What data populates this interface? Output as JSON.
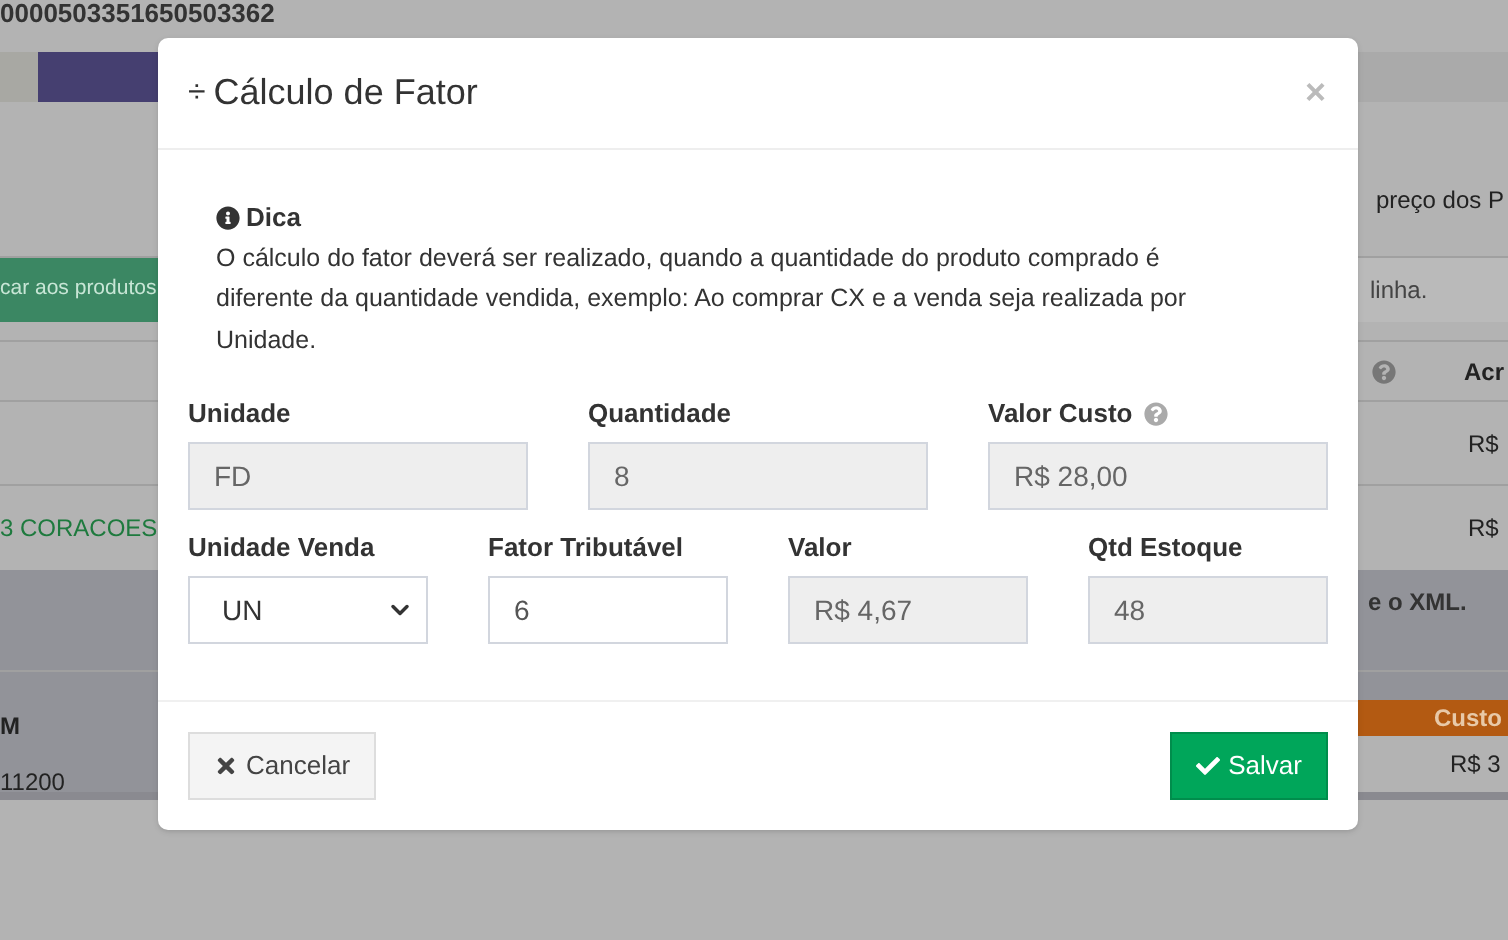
{
  "background": {
    "code": "0000503351650503362",
    "apply_button": "car aos produtos",
    "price_text": "preço dos P",
    "line_text": "linha.",
    "table_header": "Acr",
    "row_values": [
      "R$",
      "R$"
    ],
    "product_name": "3 CORACOES",
    "xml_note": "e o XML.",
    "column_m": "M",
    "code_value": "11200",
    "cost_header": "Custo",
    "cost_value": "R$ 3"
  },
  "modal": {
    "icon": "÷",
    "title": "Cálculo de Fator",
    "close": "×",
    "tip": {
      "title": "Dica",
      "text": "O cálculo do fator deverá ser realizado, quando a quantidade do produto comprado é diferente da quantidade vendida, exemplo: Ao comprar CX e a venda seja realizada por Unidade."
    },
    "rows": [
      [
        {
          "label": "Unidade",
          "kind": "readonly",
          "value": "FD",
          "help": false
        },
        {
          "label": "Quantidade",
          "kind": "readonly",
          "value": "8",
          "help": false
        },
        {
          "label": "Valor Custo",
          "kind": "readonly",
          "value": "R$ 28,00",
          "help": true
        }
      ],
      [
        {
          "label": "Unidade Venda",
          "kind": "select",
          "value": "UN",
          "help": false
        },
        {
          "label": "Fator Tributável",
          "kind": "input",
          "value": "6",
          "help": false
        },
        {
          "label": "Valor",
          "kind": "readonly",
          "value": "R$ 4,67",
          "help": false
        },
        {
          "label": "Qtd Estoque",
          "kind": "readonly",
          "value": "48",
          "help": false
        }
      ]
    ],
    "cancel": "Cancelar",
    "save": "Salvar"
  }
}
